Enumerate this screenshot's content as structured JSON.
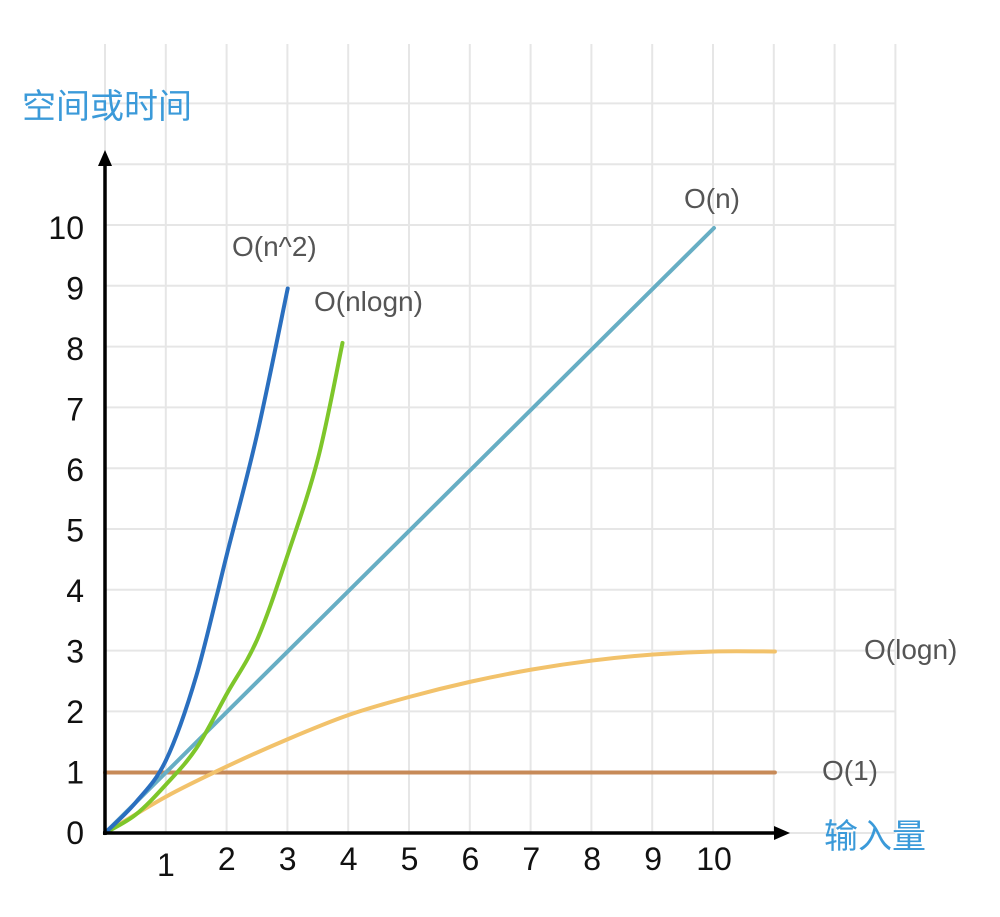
{
  "chart_data": {
    "type": "line",
    "title": "",
    "xlabel": "输入量",
    "ylabel": "空间或时间",
    "xlim": [
      0,
      11
    ],
    "ylim": [
      0,
      10
    ],
    "x_ticks": [
      "1",
      "2",
      "3",
      "4",
      "5",
      "6",
      "7",
      "8",
      "9",
      "10"
    ],
    "y_ticks": [
      "0",
      "1",
      "2",
      "3",
      "4",
      "5",
      "6",
      "7",
      "8",
      "9",
      "10"
    ],
    "grid": true,
    "series": [
      {
        "name": "O(n^2)",
        "color": "#2a6fbf",
        "x": [
          0,
          0.5,
          1,
          1.5,
          2,
          2.5,
          3
        ],
        "y": [
          0,
          0.5,
          1.2,
          2.6,
          4.6,
          6.6,
          9.0
        ]
      },
      {
        "name": "O(nlogn)",
        "color": "#7ec62a",
        "x": [
          0,
          0.5,
          1,
          1.5,
          2,
          2.5,
          3,
          3.5,
          3.9
        ],
        "y": [
          0,
          0.3,
          0.8,
          1.4,
          2.3,
          3.2,
          4.6,
          6.2,
          8.1
        ]
      },
      {
        "name": "O(n)",
        "color": "#67aec4",
        "x": [
          0,
          10
        ],
        "y": [
          0,
          10
        ]
      },
      {
        "name": "O(logn)",
        "color": "#f2c26b",
        "x": [
          0,
          1,
          2,
          3,
          4,
          5,
          6,
          7,
          8,
          9,
          10,
          11
        ],
        "y": [
          0,
          0.6,
          1.1,
          1.55,
          1.95,
          2.25,
          2.5,
          2.7,
          2.85,
          2.95,
          3.0,
          3.0
        ]
      },
      {
        "name": "O(1)",
        "color": "#c78a58",
        "x": [
          0,
          11
        ],
        "y": [
          1,
          1
        ]
      }
    ]
  }
}
